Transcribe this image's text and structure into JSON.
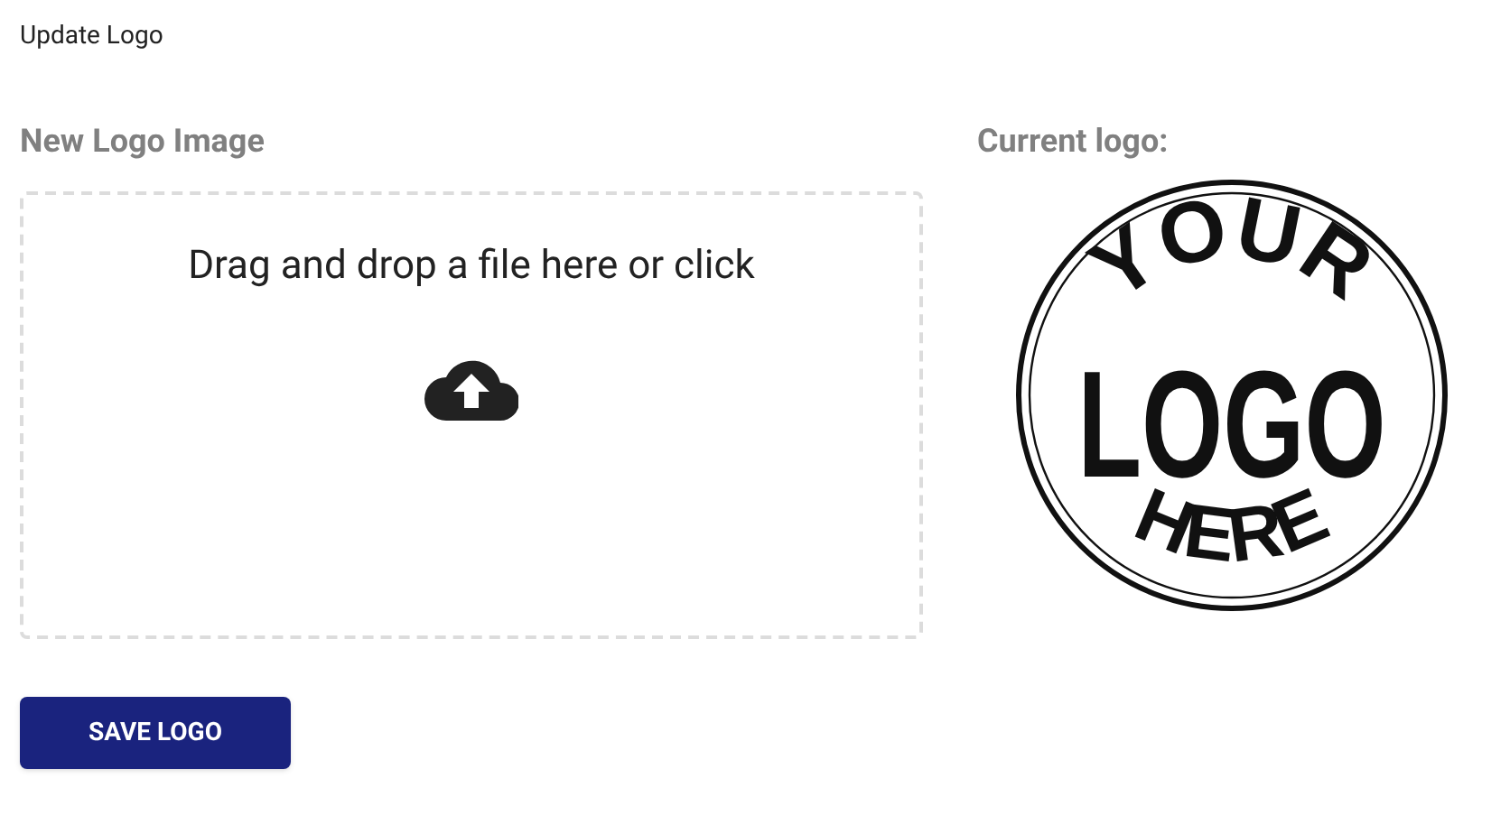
{
  "page_title": "Update Logo",
  "upload": {
    "label": "New Logo Image",
    "prompt": "Drag and drop a file here or click"
  },
  "current": {
    "label": "Current logo:",
    "logo_lines": [
      "YOUR",
      "LOGO",
      "HERE"
    ]
  },
  "save_button": "SAVE LOGO"
}
